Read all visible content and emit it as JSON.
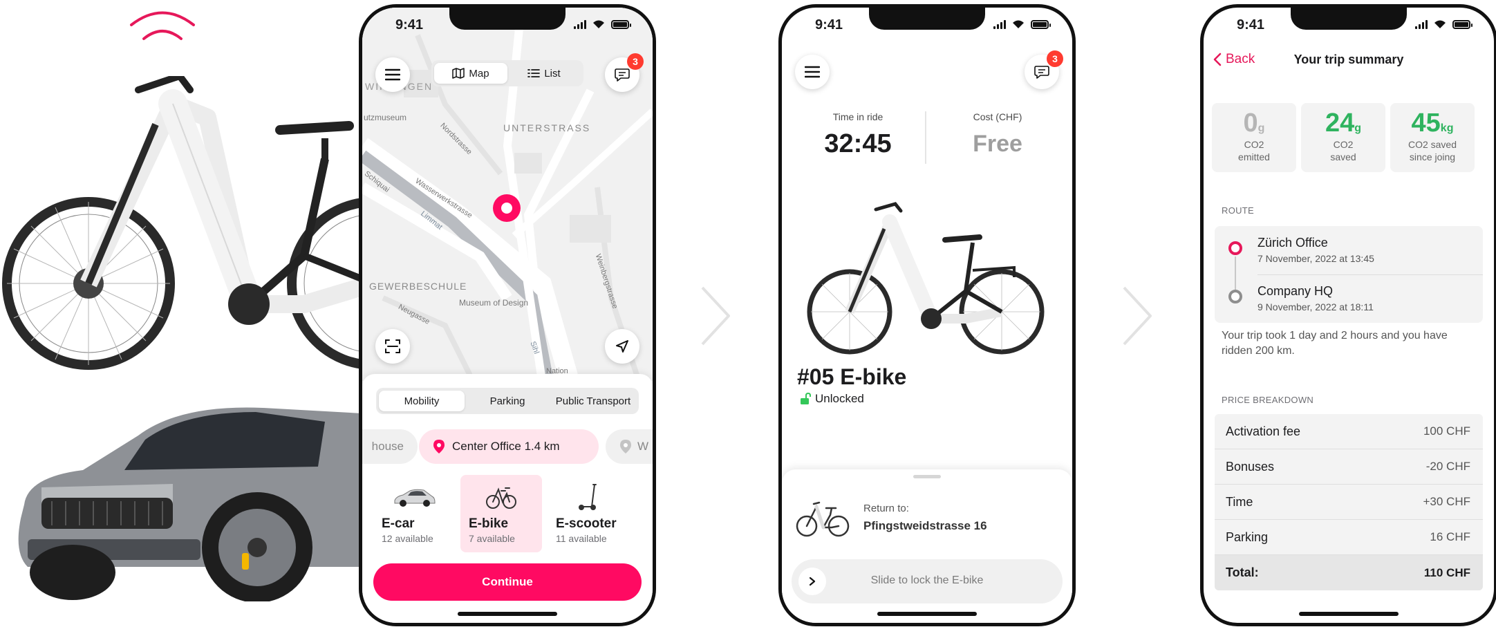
{
  "status": {
    "time": "9:41"
  },
  "screen_map": {
    "tabs": {
      "map": "Map",
      "list": "List"
    },
    "notifications_count": "3",
    "map_labels": {
      "wipkingen": "WIPKINGEN",
      "museum": "utzmuseum",
      "unterstrass": "UNTERSTRASS",
      "nordstrasse": "Nordstrasse",
      "schiquai": "Schiquai",
      "wasserwerkstrasse": "Wasserwerkstrasse",
      "limmat": "Limmat",
      "weinbergstrasse": "Weinbergstrasse",
      "gewerbeschule": "GEWERBESCHULE",
      "museum_of_design": "Museum of Design",
      "neugasse": "Neugasse",
      "sihl": "Sihl",
      "national": "Nation"
    },
    "categories": [
      "Mobility",
      "Parking",
      "Public Transport"
    ],
    "locations": {
      "prev": "house",
      "active": "Center Office 1.4 km",
      "next": "W"
    },
    "vehicles": [
      {
        "name": "E-car",
        "availability": "12 available",
        "icon": "car-icon"
      },
      {
        "name": "E-bike",
        "availability": "7 available",
        "icon": "bike-icon"
      },
      {
        "name": "E-scooter",
        "availability": "11 available",
        "icon": "scooter-icon"
      }
    ],
    "continue_label": "Continue"
  },
  "screen_ride": {
    "notifications_count": "3",
    "time_label": "Time in ride",
    "time_value": "32:45",
    "cost_label": "Cost (CHF)",
    "cost_value": "Free",
    "vehicle_number": "#05",
    "vehicle_type": "E-bike",
    "lock_status": "Unlocked",
    "return_label": "Return to:",
    "return_address": "Pfingstweidstrasse 16",
    "slide_label": "Slide to lock the E-bike"
  },
  "screen_summary": {
    "back_label": "Back",
    "title": "Your trip summary",
    "co2": [
      {
        "value": "0",
        "unit": "g",
        "label1": "CO2",
        "label2": "emitted"
      },
      {
        "value": "24",
        "unit": "g",
        "label1": "CO2",
        "label2": "saved"
      },
      {
        "value": "45",
        "unit": "kg",
        "label1": "CO2 saved",
        "label2": "since joing"
      }
    ],
    "route_label": "ROUTE",
    "route": [
      {
        "place": "Zürich Office",
        "date": "7 November, 2022 at 13:45"
      },
      {
        "place": "Company HQ",
        "date": "9 November, 2022 at 18:11"
      }
    ],
    "trip_note": "Your trip took 1 day and 2 hours and you have ridden 200 km.",
    "price_label": "PRICE BREAKDOWN",
    "price_rows": [
      {
        "label": "Activation fee",
        "value": "100 CHF"
      },
      {
        "label": "Bonuses",
        "value": "-20 CHF"
      },
      {
        "label": "Time",
        "value": "+30 CHF"
      },
      {
        "label": "Parking",
        "value": "16 CHF"
      }
    ],
    "total": {
      "label": "Total:",
      "value": "110 CHF"
    }
  },
  "colors": {
    "brand_pink": "#ff0a62",
    "back_pink": "#e6185a",
    "green": "#2fb35f",
    "badge_red": "#ff3b30"
  }
}
